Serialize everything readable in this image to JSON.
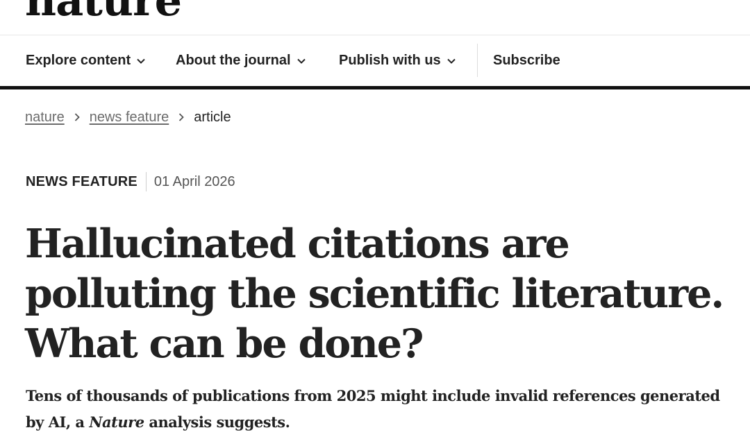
{
  "masthead": {
    "logo_text": "nature"
  },
  "nav": {
    "items": [
      {
        "label": "Explore content",
        "has_dropdown": true
      },
      {
        "label": "About the journal",
        "has_dropdown": true
      },
      {
        "label": "Publish with us",
        "has_dropdown": true
      },
      {
        "label": "Subscribe",
        "has_dropdown": false
      }
    ]
  },
  "breadcrumb": {
    "items": [
      {
        "label": "nature",
        "link": true
      },
      {
        "label": "news feature",
        "link": true
      },
      {
        "label": "article",
        "link": false
      }
    ]
  },
  "article": {
    "type": "NEWS FEATURE",
    "date": "01 April 2026",
    "title": "Hallucinated citations are polluting the scientific literature. What can be done?",
    "standfirst": {
      "before_italic": "Tens of thousands of publications from 2025 might include invalid references generated by AI, a ",
      "italic": "Nature",
      "after_italic": " analysis suggests."
    }
  },
  "colors": {
    "text": "#222222",
    "muted": "#6b6b6b",
    "rule": "#111111",
    "divider": "#dcdcdc"
  },
  "icons": {
    "dropdown": "chevron-down-icon",
    "breadcrumb_separator": "chevron-right-icon"
  }
}
